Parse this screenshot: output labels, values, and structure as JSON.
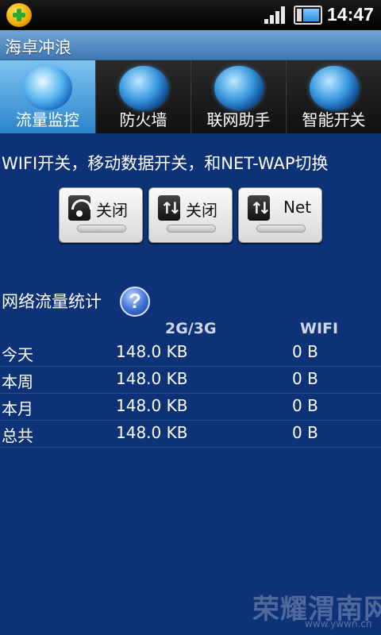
{
  "status_bar": {
    "time": "14:47"
  },
  "app": {
    "title": "海卓冲浪"
  },
  "tabs": [
    {
      "label": "流量监控",
      "icon": "traffic-monitor-icon",
      "active": true
    },
    {
      "label": "防火墙",
      "icon": "firewall-icon",
      "active": false
    },
    {
      "label": "联网助手",
      "icon": "network-assistant-icon",
      "active": false
    },
    {
      "label": "智能开关",
      "icon": "smart-switch-icon",
      "active": false
    }
  ],
  "switches": {
    "headline": "WIFI开关，移动数据开关，和NET-WAP切换",
    "buttons": [
      {
        "icon": "wifi-icon",
        "label": "关闭"
      },
      {
        "icon": "mobile-data-icon",
        "label": "关闭"
      },
      {
        "icon": "net-wap-icon",
        "label": "Net"
      }
    ]
  },
  "stats": {
    "title": "网络流量统计",
    "help_icon": "help-icon",
    "headers": {
      "mobile": "2G/3G",
      "wifi": "WIFI"
    },
    "rows": [
      {
        "name": "今天",
        "mobile": "148.0 KB",
        "wifi": "0 B"
      },
      {
        "name": "本周",
        "mobile": "148.0 KB",
        "wifi": "0 B"
      },
      {
        "name": "本月",
        "mobile": "148.0 KB",
        "wifi": "0 B"
      },
      {
        "name": "总共",
        "mobile": "148.0 KB",
        "wifi": "0 B"
      }
    ]
  },
  "watermark": {
    "title": "荣耀渭南网",
    "url": "www.ywwn.cn"
  },
  "colors": {
    "background": "#0e3277",
    "title_bar": "#4f86bd",
    "active_tab": "#3a9ae0"
  }
}
